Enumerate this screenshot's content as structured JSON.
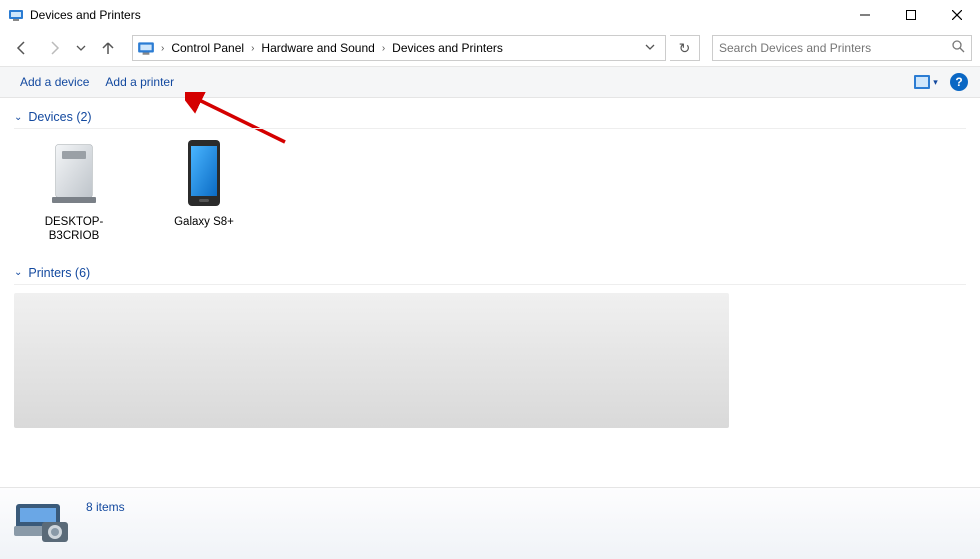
{
  "window": {
    "title": "Devices and Printers"
  },
  "breadcrumbs": {
    "0": {
      "label": "Control Panel"
    },
    "1": {
      "label": "Hardware and Sound"
    },
    "2": {
      "label": "Devices and Printers"
    }
  },
  "search": {
    "placeholder": "Search Devices and Printers"
  },
  "toolbar": {
    "add_device": "Add a device",
    "add_printer": "Add a printer"
  },
  "groups": {
    "devices": {
      "header": "Devices (2)"
    },
    "printers": {
      "header": "Printers (6)"
    }
  },
  "devices": {
    "0": {
      "label": "DESKTOP-B3CRIOB"
    },
    "1": {
      "label": "Galaxy S8+"
    }
  },
  "status": {
    "items_text": "8 items"
  }
}
